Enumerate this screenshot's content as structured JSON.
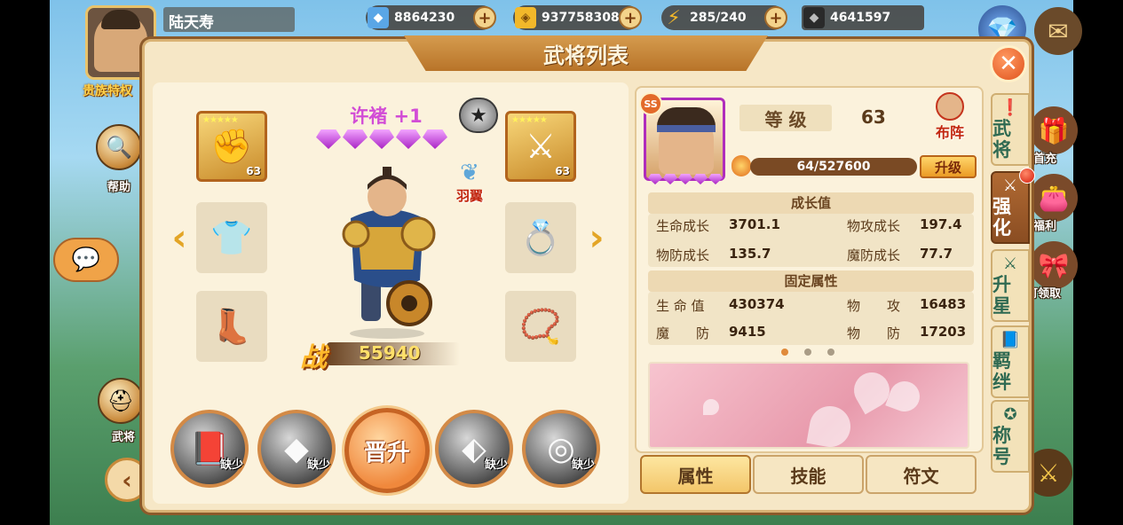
{
  "player": {
    "name": "陆天寿",
    "noble_tag": "贵族特权"
  },
  "resources": [
    {
      "name": "diamond",
      "icon": "diamond-icon",
      "value": "8864230",
      "color": "#5aa6e6"
    },
    {
      "name": "gold",
      "icon": "gold-coin-icon",
      "value": "937758308",
      "color": "#f2b82a"
    },
    {
      "name": "stamina",
      "icon": "lightning-icon",
      "value": "285/240",
      "color": "#f2b82a"
    },
    {
      "name": "ore",
      "icon": "ore-icon",
      "value": "4641597",
      "color": "#2a2a2a"
    }
  ],
  "left_side": {
    "help": "帮助",
    "generals": "武将"
  },
  "right_side": {
    "first_charge": "首充",
    "welfare": "福利",
    "claimable": "可领取"
  },
  "title": "武将列表",
  "hero": {
    "name": "许褚 +1",
    "wing_label": "羽翼",
    "power_label": "战",
    "power": "55940",
    "equip": [
      {
        "name": "equip-gauntlet",
        "level": "63",
        "stars": "★★★★★"
      },
      {
        "name": "equip-weapon",
        "level": "63",
        "stars": "★★★★★"
      }
    ]
  },
  "skills": {
    "missing": "缺少",
    "promote": "晋升"
  },
  "detail": {
    "level_label": "等 级",
    "level": "63",
    "formation": "布阵",
    "exp": "64/527600",
    "upgrade": "升级",
    "growth_header": "成长值",
    "growth": [
      {
        "label": "生命成长",
        "value": "3701.1"
      },
      {
        "label": "物攻成长",
        "value": "197.4"
      },
      {
        "label": "物防成长",
        "value": "135.7"
      },
      {
        "label": "魔防成长",
        "value": "77.7"
      }
    ],
    "fixed_header": "固定属性",
    "fixed": [
      {
        "label": "生 命 值",
        "value": "430374"
      },
      {
        "label": "物　　攻",
        "value": "16483"
      },
      {
        "label": "魔　　防",
        "value": "9415"
      },
      {
        "label": "物　　防",
        "value": "17203"
      }
    ]
  },
  "bottom_tabs": [
    "属性",
    "技能",
    "符文"
  ],
  "side_tabs": [
    {
      "icon": "exclaim-icon",
      "label": "武将"
    },
    {
      "icon": "swords-icon",
      "label": "强化"
    },
    {
      "icon": "swords-icon",
      "label": "升星"
    },
    {
      "icon": "book-icon",
      "label": "羁绊"
    },
    {
      "icon": "star-icon",
      "label": "称号"
    }
  ]
}
